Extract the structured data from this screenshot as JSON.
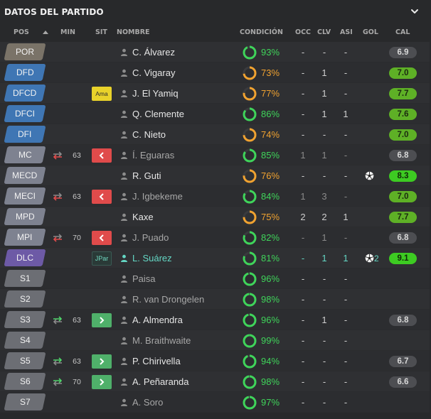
{
  "panel": {
    "title": "DATOS DEL PARTIDO"
  },
  "columns": {
    "pos": "POS",
    "min": "MIN",
    "sit": "SIT",
    "name": "NOMBRE",
    "condition": "CONDICIÓN",
    "occ": "OCC",
    "clv": "CLV",
    "asi": "ASI",
    "gol": "GOL",
    "cal": "CAL"
  },
  "colors": {
    "condition_green": "#3fd45a",
    "condition_orange": "#f0a230",
    "rating_green": "#5eb026",
    "rating_bright": "#3dcb22",
    "rating_grey": "#4d4e52",
    "highlight": "#64d7c4",
    "sub_out": "#e04b4b",
    "sub_in": "#4fb06a"
  },
  "players": [
    {
      "pos": "POR",
      "pos_group": "gk",
      "min": "",
      "sub": "",
      "sit_tag": "",
      "name": "C. Álvarez",
      "name_style": "",
      "condition": "93%",
      "condition_pct": 93,
      "condition_color": "#3fd45a",
      "occ": "-",
      "clv": "-",
      "asi": "-",
      "gol": "",
      "gol_icon": "",
      "rating": "6.9",
      "rating_style": "grey"
    },
    {
      "pos": "DFD",
      "pos_group": "def",
      "min": "",
      "sub": "",
      "sit_tag": "",
      "name": "C. Vigaray",
      "name_style": "",
      "condition": "73%",
      "condition_pct": 73,
      "condition_color": "#f0a230",
      "occ": "-",
      "clv": "1",
      "asi": "-",
      "gol": "",
      "gol_icon": "",
      "rating": "7.0",
      "rating_style": "green"
    },
    {
      "pos": "DFCD",
      "pos_group": "def",
      "min": "",
      "sub": "",
      "sit_tag": "Ama",
      "sit_tag_style": "yellow",
      "name": "J. El Yamiq",
      "name_style": "",
      "condition": "77%",
      "condition_pct": 77,
      "condition_color": "#f0a230",
      "occ": "-",
      "clv": "1",
      "asi": "-",
      "gol": "",
      "gol_icon": "",
      "rating": "7.7",
      "rating_style": "green"
    },
    {
      "pos": "DFCI",
      "pos_group": "def",
      "min": "",
      "sub": "",
      "sit_tag": "",
      "name": "Q. Clemente",
      "name_style": "",
      "condition": "86%",
      "condition_pct": 86,
      "condition_color": "#3fd45a",
      "occ": "-",
      "clv": "1",
      "asi": "1",
      "gol": "",
      "gol_icon": "",
      "rating": "7.6",
      "rating_style": "green"
    },
    {
      "pos": "DFI",
      "pos_group": "def",
      "min": "",
      "sub": "",
      "sit_tag": "",
      "name": "C. Nieto",
      "name_style": "",
      "condition": "74%",
      "condition_pct": 74,
      "condition_color": "#f0a230",
      "occ": "-",
      "clv": "-",
      "asi": "-",
      "gol": "",
      "gol_icon": "",
      "rating": "7.0",
      "rating_style": "green"
    },
    {
      "pos": "MC",
      "pos_group": "mid",
      "min": "63",
      "sub": "out",
      "sit_tag": "",
      "name": "Í. Eguaras",
      "name_style": "dim",
      "condition": "85%",
      "condition_pct": 85,
      "condition_color": "#3fd45a",
      "occ": "1",
      "clv": "1",
      "asi": "-",
      "gol": "",
      "gol_icon": "",
      "rating": "6.8",
      "rating_style": "grey",
      "stats_dim": true
    },
    {
      "pos": "MECD",
      "pos_group": "mid",
      "min": "",
      "sub": "",
      "sit_tag": "",
      "name": "R. Guti",
      "name_style": "",
      "condition": "76%",
      "condition_pct": 76,
      "condition_color": "#f0a230",
      "occ": "-",
      "clv": "-",
      "asi": "-",
      "gol": "",
      "gol_icon": "ball",
      "rating": "8.3",
      "rating_style": "bright"
    },
    {
      "pos": "MECI",
      "pos_group": "mid",
      "min": "63",
      "sub": "out",
      "sit_tag": "",
      "name": "J. Igbekeme",
      "name_style": "dim",
      "condition": "84%",
      "condition_pct": 84,
      "condition_color": "#3fd45a",
      "occ": "1",
      "clv": "3",
      "asi": "-",
      "gol": "",
      "gol_icon": "",
      "rating": "7.0",
      "rating_style": "green",
      "stats_dim": true
    },
    {
      "pos": "MPD",
      "pos_group": "mid",
      "min": "",
      "sub": "",
      "sit_tag": "",
      "name": "Kaxe",
      "name_style": "",
      "condition": "75%",
      "condition_pct": 75,
      "condition_color": "#f0a230",
      "occ": "2",
      "clv": "2",
      "asi": "1",
      "gol": "",
      "gol_icon": "",
      "rating": "7.7",
      "rating_style": "green"
    },
    {
      "pos": "MPI",
      "pos_group": "mid",
      "min": "70",
      "sub": "out",
      "sit_tag": "",
      "name": "J. Puado",
      "name_style": "dim",
      "condition": "82%",
      "condition_pct": 82,
      "condition_color": "#3fd45a",
      "occ": "-",
      "clv": "1",
      "asi": "-",
      "gol": "",
      "gol_icon": "",
      "rating": "6.8",
      "rating_style": "grey",
      "stats_dim": true
    },
    {
      "pos": "DLC",
      "pos_group": "att",
      "min": "",
      "sub": "",
      "sit_tag": "JPar",
      "sit_tag_style": "jpar",
      "name": "L. Suárez",
      "name_style": "hl",
      "condition": "81%",
      "condition_pct": 81,
      "condition_color": "#3fd45a",
      "occ": "-",
      "clv": "1",
      "asi": "1",
      "gol": "2",
      "gol_icon": "ball",
      "rating": "9.1",
      "rating_style": "bright",
      "stats_hl": true
    },
    {
      "pos": "S1",
      "pos_group": "sub",
      "min": "",
      "sub": "",
      "sit_tag": "",
      "name": "Paisa",
      "name_style": "dim",
      "condition": "96%",
      "condition_pct": 96,
      "condition_color": "#3fd45a",
      "occ": "-",
      "clv": "-",
      "asi": "-",
      "gol": "",
      "gol_icon": "",
      "rating": "",
      "rating_style": ""
    },
    {
      "pos": "S2",
      "pos_group": "sub",
      "min": "",
      "sub": "",
      "sit_tag": "",
      "name": "R. van Drongelen",
      "name_style": "dim",
      "condition": "98%",
      "condition_pct": 98,
      "condition_color": "#3fd45a",
      "occ": "-",
      "clv": "-",
      "asi": "-",
      "gol": "",
      "gol_icon": "",
      "rating": "",
      "rating_style": ""
    },
    {
      "pos": "S3",
      "pos_group": "sub",
      "min": "63",
      "sub": "in",
      "sit_tag": "",
      "name": "A. Almendra",
      "name_style": "",
      "condition": "96%",
      "condition_pct": 96,
      "condition_color": "#3fd45a",
      "occ": "-",
      "clv": "1",
      "asi": "-",
      "gol": "",
      "gol_icon": "",
      "rating": "6.8",
      "rating_style": "grey"
    },
    {
      "pos": "S4",
      "pos_group": "sub",
      "min": "",
      "sub": "",
      "sit_tag": "",
      "name": "M. Braithwaite",
      "name_style": "dim",
      "condition": "99%",
      "condition_pct": 99,
      "condition_color": "#3fd45a",
      "occ": "-",
      "clv": "-",
      "asi": "-",
      "gol": "",
      "gol_icon": "",
      "rating": "",
      "rating_style": ""
    },
    {
      "pos": "S5",
      "pos_group": "sub",
      "min": "63",
      "sub": "in",
      "sit_tag": "",
      "name": "P. Chirivella",
      "name_style": "",
      "condition": "94%",
      "condition_pct": 94,
      "condition_color": "#3fd45a",
      "occ": "-",
      "clv": "-",
      "asi": "-",
      "gol": "",
      "gol_icon": "",
      "rating": "6.7",
      "rating_style": "grey"
    },
    {
      "pos": "S6",
      "pos_group": "sub",
      "min": "70",
      "sub": "in",
      "sit_tag": "",
      "name": "A. Peñaranda",
      "name_style": "",
      "condition": "98%",
      "condition_pct": 98,
      "condition_color": "#3fd45a",
      "occ": "-",
      "clv": "-",
      "asi": "-",
      "gol": "",
      "gol_icon": "",
      "rating": "6.6",
      "rating_style": "grey"
    },
    {
      "pos": "S7",
      "pos_group": "sub",
      "min": "",
      "sub": "",
      "sit_tag": "",
      "name": "A. Soro",
      "name_style": "dim",
      "condition": "97%",
      "condition_pct": 97,
      "condition_color": "#3fd45a",
      "occ": "-",
      "clv": "-",
      "asi": "-",
      "gol": "",
      "gol_icon": "",
      "rating": "",
      "rating_style": ""
    }
  ]
}
